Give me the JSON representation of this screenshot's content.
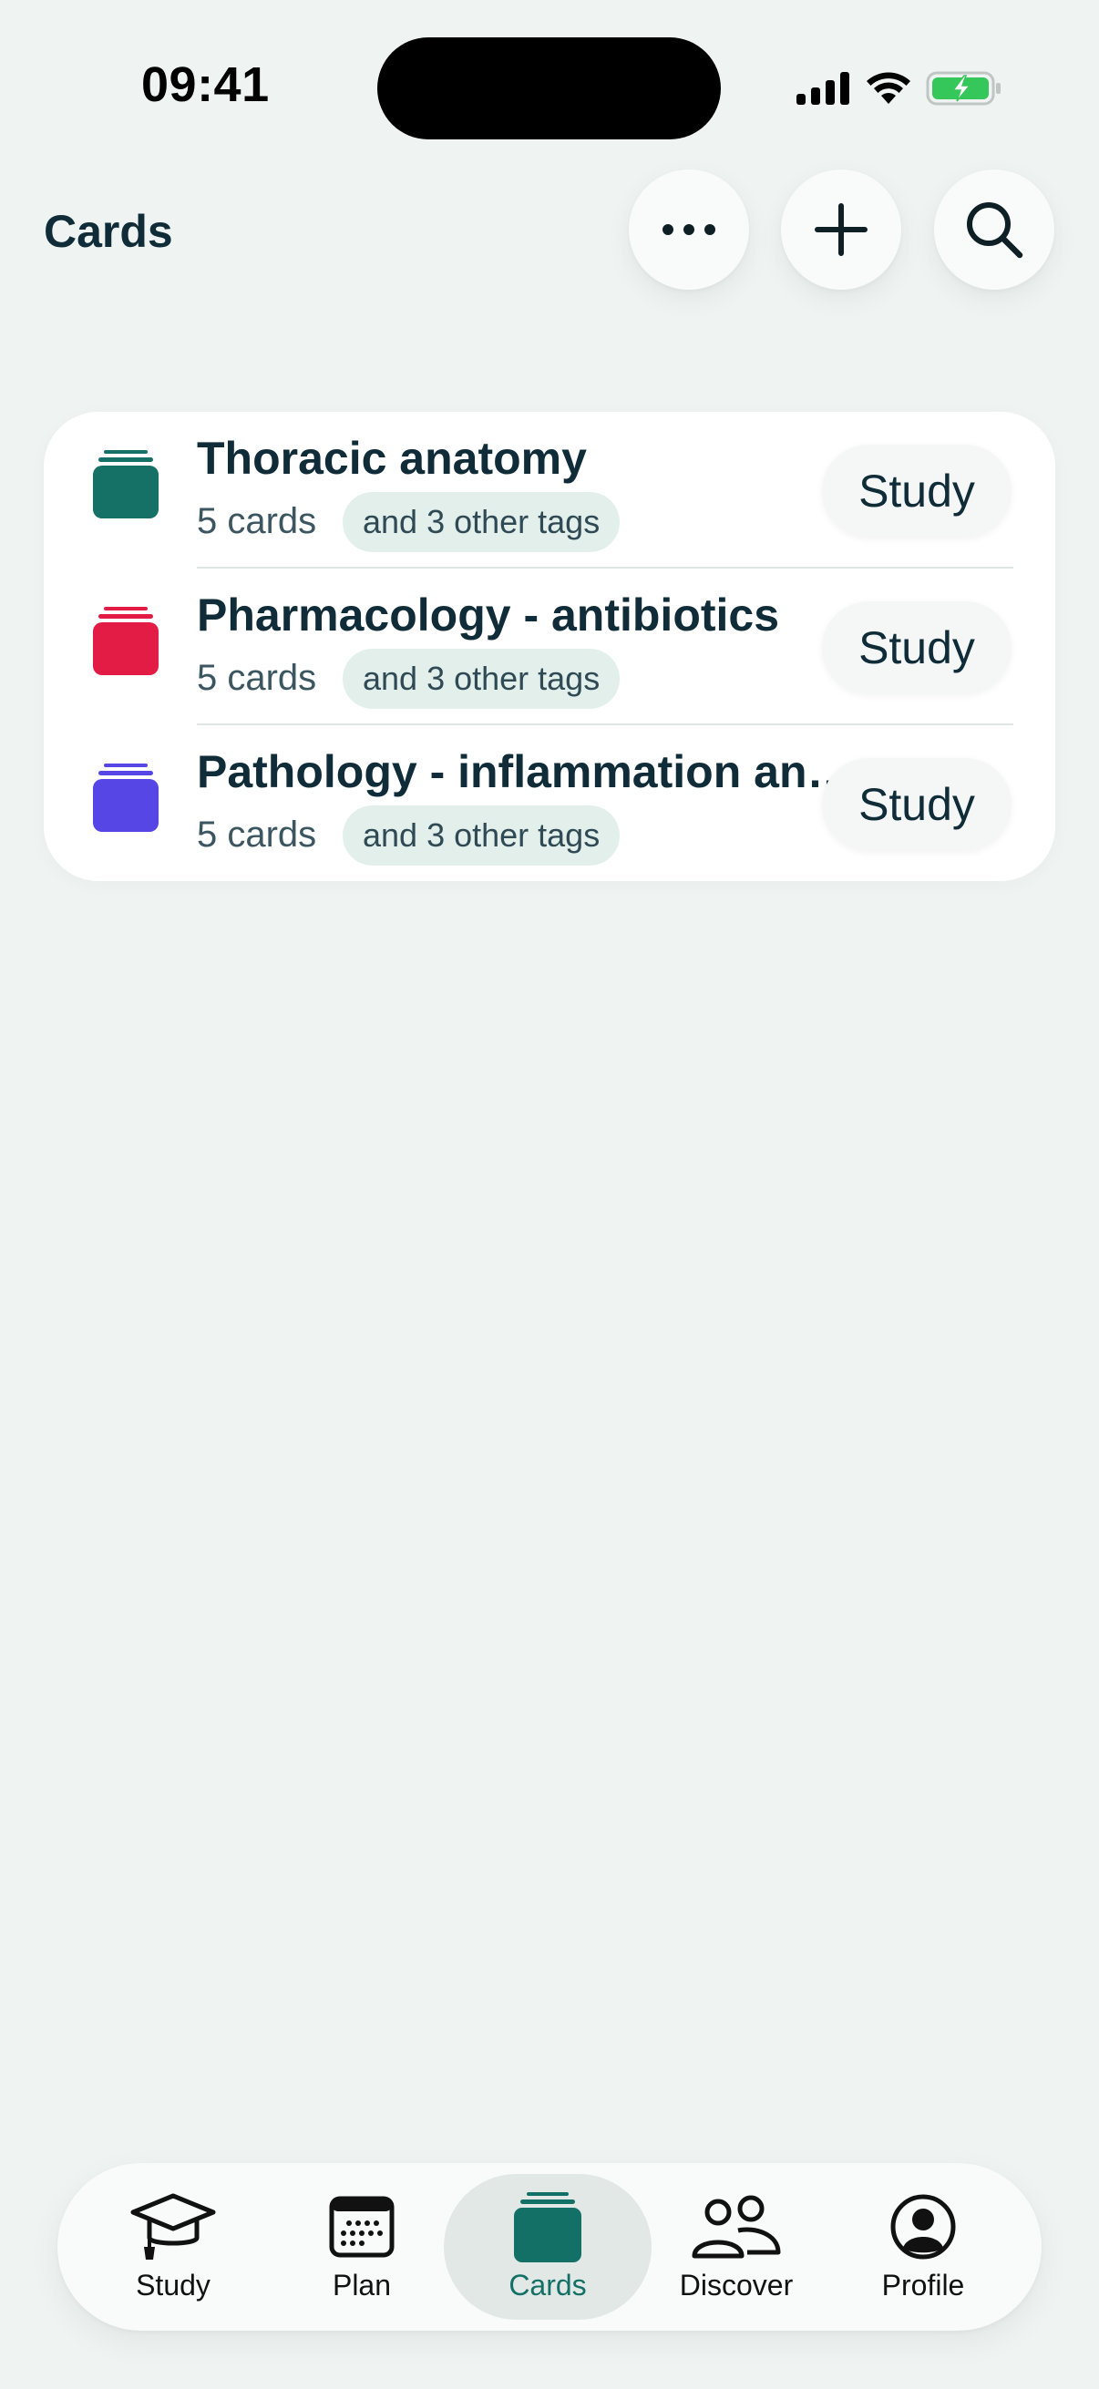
{
  "status_bar": {
    "time": "09:41"
  },
  "header": {
    "title": "Cards"
  },
  "decks": [
    {
      "title": "Thoracic anatomy",
      "count": "5 cards",
      "tags": "and 3 other tags",
      "study_label": "Study",
      "color": "#157166"
    },
    {
      "title": "Pharmacology - antibiotics",
      "count": "5 cards",
      "tags": "and 3 other tags",
      "study_label": "Study",
      "color": "#e31c45"
    },
    {
      "title": "Pathology - inflammation and repair",
      "count": "5 cards",
      "tags": "and 3 other tags",
      "study_label": "Study",
      "color": "#5746e6"
    }
  ],
  "tab_bar": {
    "items": [
      {
        "label": "Study",
        "icon": "graduation-cap-icon"
      },
      {
        "label": "Plan",
        "icon": "calendar-icon"
      },
      {
        "label": "Cards",
        "icon": "cards-stack-icon",
        "active": true
      },
      {
        "label": "Discover",
        "icon": "people-icon"
      },
      {
        "label": "Profile",
        "icon": "person-circle-icon"
      }
    ]
  },
  "colors": {
    "accent": "#137066",
    "background": "#eff4f2",
    "title": "#0f2c38"
  }
}
